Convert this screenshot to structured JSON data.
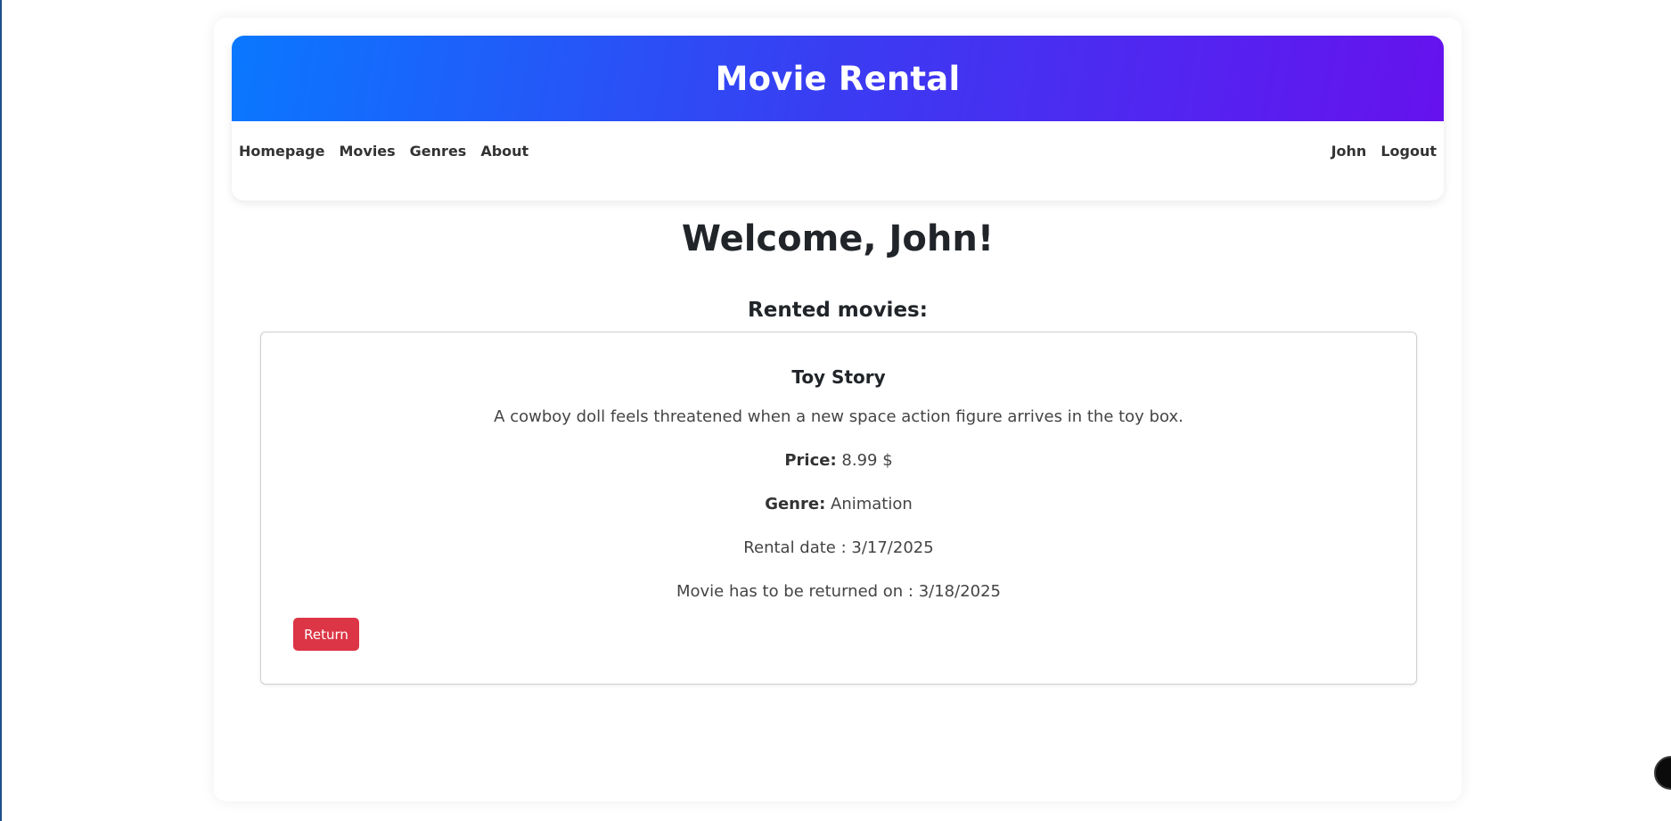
{
  "header": {
    "title": "Movie Rental"
  },
  "nav": {
    "left": [
      "Homepage",
      "Movies",
      "Genres",
      "About"
    ],
    "right": [
      "John",
      "Logout"
    ]
  },
  "welcome": "Welcome, John!",
  "rented_heading": "Rented movies:",
  "rented_movies": [
    {
      "title": "Toy Story",
      "description": "A cowboy doll feels threatened when a new space action figure arrives in the toy box.",
      "price_label": "Price:",
      "price_value": "8.99 $",
      "genre_label": "Genre:",
      "genre_value": "Animation",
      "rental_date": "Rental date : 3/17/2025",
      "return_date": "Movie has to be returned on : 3/18/2025",
      "return_button": "Return"
    }
  ],
  "colors": {
    "banner_start": "#0a78ff",
    "banner_end": "#6612ee",
    "return_button": "#dc3545"
  }
}
